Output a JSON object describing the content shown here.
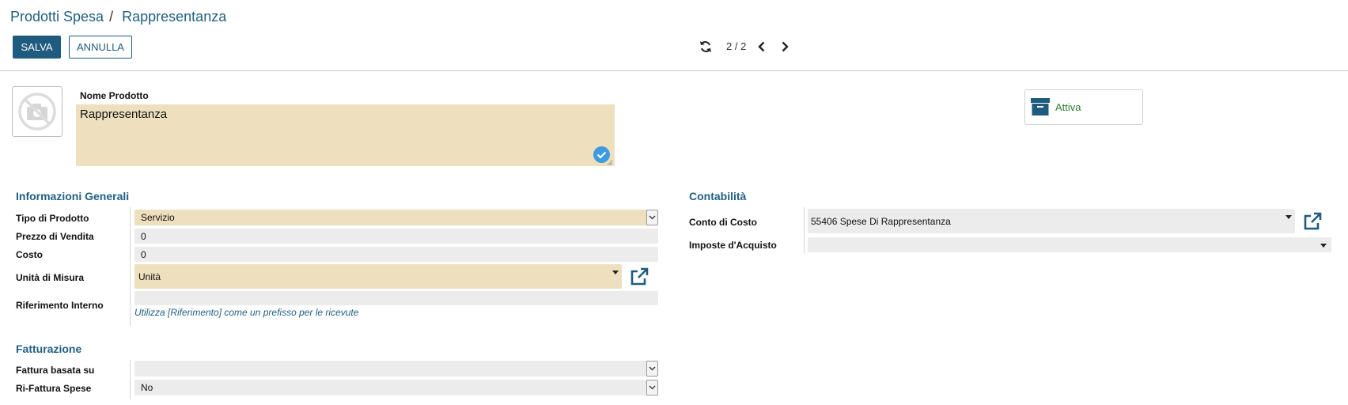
{
  "breadcrumb": {
    "parent": "Prodotti Spesa",
    "separator": "/",
    "current": "Rappresentanza"
  },
  "toolbar": {
    "save_label": "SALVA",
    "cancel_label": "ANNULLA"
  },
  "pager": {
    "value": "2 / 2"
  },
  "product": {
    "name_label": "Nome Prodotto",
    "name_value": "Rappresentanza"
  },
  "status_button": {
    "label": "Attiva"
  },
  "general": {
    "title": "Informazioni Generali",
    "product_type_label": "Tipo di Prodotto",
    "product_type_value": "Servizio",
    "sale_price_label": "Prezzo di Vendita",
    "sale_price_value": "0",
    "cost_label": "Costo",
    "cost_value": "0",
    "uom_label": "Unità di Misura",
    "uom_value": "Unità",
    "internal_ref_label": "Riferimento Interno",
    "internal_ref_value": "",
    "internal_ref_hint": "Utilizza [Riferimento] come un prefisso per le ricevute"
  },
  "invoicing": {
    "title": "Fatturazione",
    "invoice_based_label": "Fattura basata su",
    "invoice_based_value": "",
    "reinvoice_label": "Ri-Fattura Spese",
    "reinvoice_value": "No"
  },
  "accounting": {
    "title": "Contabilità",
    "cost_account_label": "Conto di Costo",
    "cost_account_value": "55406 Spese Di Rappresentanza",
    "purchase_taxes_label": "Imposte d'Acquisto",
    "purchase_taxes_value": ""
  },
  "colors": {
    "primary": "#1e5b7e",
    "required_field": "#eedfbe",
    "active": "#2e7d32"
  },
  "icons": {
    "refresh": "refresh-icon",
    "prev": "chevron-left-icon",
    "next": "chevron-right-icon",
    "photo": "no-camera-icon",
    "check": "check-circle-icon",
    "archive": "archive-icon",
    "external": "external-link-icon"
  }
}
